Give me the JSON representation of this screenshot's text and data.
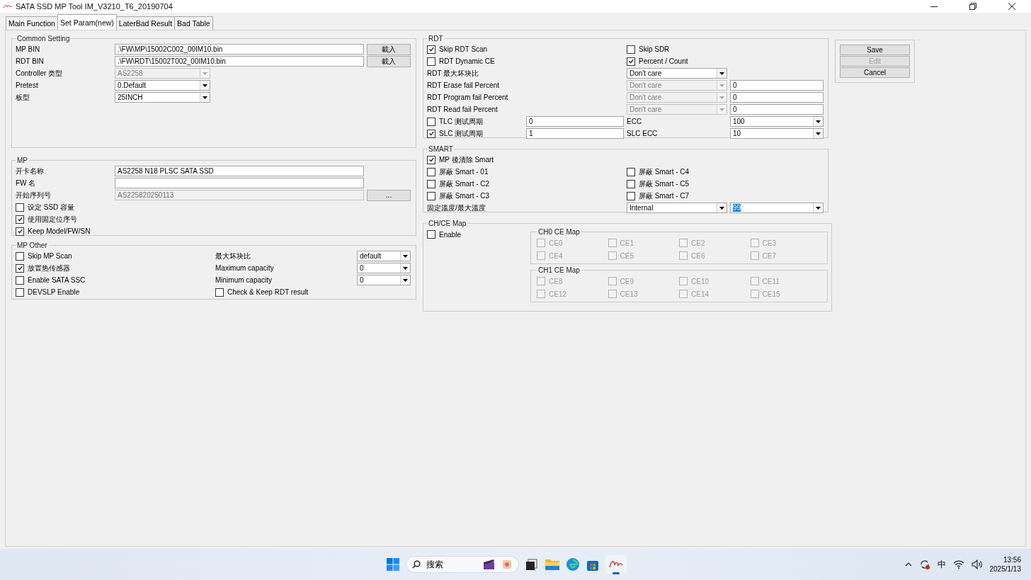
{
  "window": {
    "title": "SATA SSD MP Tool IM_V3210_T6_20190704"
  },
  "tabs": [
    {
      "label": "Main Function",
      "selected": false
    },
    {
      "label": "Set Param(new)",
      "selected": true
    },
    {
      "label": "LaterBad Result",
      "selected": false
    },
    {
      "label": "Bad Table",
      "selected": false
    }
  ],
  "common_setting": {
    "title": "Common Setting",
    "rows": [
      {
        "label": "MP BIN",
        "field": {
          "kind": "text",
          "value": ".\\FW\\MP\\15002C002_00IM10.bin",
          "disabled": false
        },
        "button": "載入"
      },
      {
        "label": "RDT BIN",
        "field": {
          "kind": "text",
          "value": ".\\FW\\RDT\\15002T002_00IM10.bin",
          "disabled": false
        },
        "button": "載入"
      },
      {
        "label": "Controller 类型",
        "field": {
          "kind": "combo",
          "value": "AS2258",
          "disabled": true
        }
      },
      {
        "label": "Pretest",
        "field": {
          "kind": "combo",
          "value": "0.Default",
          "disabled": false
        }
      },
      {
        "label": "板型",
        "field": {
          "kind": "combo",
          "value": "25INCH",
          "disabled": false
        }
      }
    ]
  },
  "mp": {
    "title": "MP",
    "rows": [
      {
        "label": "开卡名称",
        "field": {
          "kind": "text",
          "value": "AS2258 N18 PLSC SATA SSD",
          "disabled": false
        }
      },
      {
        "label": "FW 名",
        "field": {
          "kind": "text",
          "disabled": false
        }
      },
      {
        "label": "开始序列号",
        "field": {
          "kind": "text",
          "value": "AS225820250113",
          "disabled": true
        },
        "button": "..."
      }
    ],
    "checks": [
      {
        "label": "设定 SSD 容量",
        "checked": false
      },
      {
        "label": "使用固定位序号",
        "checked": true
      },
      {
        "label": "Keep Model/FW/SN",
        "checked": true
      }
    ]
  },
  "mp_other": {
    "title": "MP Other",
    "rows": [
      {
        "left": {
          "kind": "checkbox",
          "label": "Skip MP Scan",
          "checked": false
        },
        "right": {
          "kind": "label",
          "text": "最大坏块比"
        },
        "right_field": {
          "kind": "combo",
          "value": "default",
          "disabled": false
        }
      },
      {
        "left": {
          "kind": "checkbox",
          "label": "放置热传感器",
          "checked": true
        },
        "right": {
          "kind": "label",
          "text": "Maximum capacity"
        },
        "right_field": {
          "kind": "combo",
          "value": "0",
          "disabled": false
        }
      },
      {
        "left": {
          "kind": "checkbox",
          "label": "Enable SATA SSC",
          "checked": false
        },
        "right": {
          "kind": "label",
          "text": "Minimum capacity"
        },
        "right_field": {
          "kind": "combo",
          "value": "0",
          "disabled": false
        }
      },
      {
        "left": {
          "kind": "checkbox",
          "label": "DEVSLP Enable",
          "checked": false
        },
        "right": {
          "kind": "checkbox",
          "label": "Check & Keep RDT result",
          "checked": false
        }
      }
    ]
  },
  "rdt": {
    "title": "RDT",
    "rows": [
      {
        "left": {
          "kind": "checkbox",
          "label": "Skip RDT Scan",
          "checked": true
        },
        "right": {
          "kind": "checkbox",
          "label": "Skip SDR",
          "checked": false
        }
      },
      {
        "left": {
          "kind": "checkbox",
          "label": "RDT Dynamic CE",
          "checked": false
        },
        "right": {
          "kind": "checkbox",
          "label": "Percent / Count",
          "checked": true
        }
      },
      {
        "left": {
          "kind": "label",
          "text": "RDT 最大坏块比"
        },
        "right": {
          "kind": "combo",
          "value": "Don't care",
          "disabled": false
        }
      },
      {
        "left": {
          "kind": "label",
          "text": "RDT Erase fail Percent"
        },
        "right": {
          "kind": "combo",
          "value": "Don't care",
          "disabled": true
        },
        "right_field": {
          "kind": "text",
          "value": "0",
          "disabled": false
        }
      },
      {
        "left": {
          "kind": "label",
          "text": "RDT Program fail Percent"
        },
        "right": {
          "kind": "combo",
          "value": "Don't care",
          "disabled": true
        },
        "right_field": {
          "kind": "text",
          "value": "0",
          "disabled": false
        }
      },
      {
        "left": {
          "kind": "label",
          "text": "RDT Read fail Percent"
        },
        "right": {
          "kind": "combo",
          "value": "Don't care",
          "disabled": true
        },
        "right_field": {
          "kind": "text",
          "value": "0",
          "disabled": false
        }
      },
      {
        "left": {
          "kind": "checkbox",
          "label": "TLC 测试周期",
          "checked": false
        },
        "left_field": {
          "kind": "text",
          "value": "0",
          "disabled": false
        },
        "right": {
          "kind": "label",
          "text": "ECC"
        },
        "right_field": {
          "kind": "combo",
          "value": "100",
          "disabled": false
        }
      },
      {
        "left": {
          "kind": "checkbox",
          "label": "SLC 测试周期",
          "checked": true
        },
        "left_field": {
          "kind": "text",
          "value": "1",
          "disabled": false
        },
        "right": {
          "kind": "label",
          "text": "SLC ECC"
        },
        "right_field": {
          "kind": "combo",
          "value": "10",
          "disabled": false
        }
      }
    ]
  },
  "smart": {
    "title": "SMART",
    "rows": [
      {
        "left": {
          "kind": "checkbox",
          "label": "MP 後清除 Smart",
          "checked": true
        }
      },
      {
        "left": {
          "kind": "checkbox",
          "label": "屏蔽 Smart - 01",
          "checked": false
        },
        "right": {
          "kind": "checkbox",
          "label": "屏蔽 Smart - C4",
          "checked": false
        }
      },
      {
        "left": {
          "kind": "checkbox",
          "label": "屏蔽 Smart - C2",
          "checked": false
        },
        "right": {
          "kind": "checkbox",
          "label": "屏蔽 Smart - C5",
          "checked": false
        }
      },
      {
        "left": {
          "kind": "checkbox",
          "label": "屏蔽 Smart - C3",
          "checked": false
        },
        "right": {
          "kind": "checkbox",
          "label": "屏蔽 Smart - C7",
          "checked": false
        }
      },
      {
        "left": {
          "kind": "label",
          "text": "固定溫度/最大溫度"
        },
        "right": {
          "kind": "combo",
          "value": "Internal",
          "disabled": false
        },
        "right_field": {
          "kind": "combo",
          "value": "99",
          "disabled": false,
          "highlighted": true
        }
      }
    ]
  },
  "ch_ce_map": {
    "title": "CH/CE Map",
    "enable": {
      "label": "Enable",
      "checked": false
    },
    "maps": [
      {
        "title": "CH0 CE Map",
        "items": [
          {
            "label": "CE0",
            "checked": false,
            "disabled": true
          },
          {
            "label": "CE1",
            "checked": false,
            "disabled": true
          },
          {
            "label": "CE2",
            "checked": false,
            "disabled": true
          },
          {
            "label": "CE3",
            "checked": false,
            "disabled": true
          },
          {
            "label": "CE4",
            "checked": false,
            "disabled": true
          },
          {
            "label": "CE5",
            "checked": false,
            "disabled": true
          },
          {
            "label": "CE6",
            "checked": false,
            "disabled": true
          },
          {
            "label": "CE7",
            "checked": false,
            "disabled": true
          }
        ]
      },
      {
        "title": "CH1 CE Map",
        "items": [
          {
            "label": "CE8",
            "checked": false,
            "disabled": true
          },
          {
            "label": "CE9",
            "checked": false,
            "disabled": true
          },
          {
            "label": "CE10",
            "checked": false,
            "disabled": true
          },
          {
            "label": "CE11",
            "checked": false,
            "disabled": true
          },
          {
            "label": "CE12",
            "checked": false,
            "disabled": true
          },
          {
            "label": "CE13",
            "checked": false,
            "disabled": true
          },
          {
            "label": "CE14",
            "checked": false,
            "disabled": true
          },
          {
            "label": "CE15",
            "checked": false,
            "disabled": true
          }
        ]
      }
    ]
  },
  "actions": [
    {
      "label": "Save",
      "disabled": false
    },
    {
      "label": "Edit",
      "disabled": true
    },
    {
      "label": "Cancel",
      "disabled": false
    }
  ],
  "taskbar": {
    "search": "搜索",
    "input_method": "中",
    "time": "13:56",
    "date": "2025/1/13"
  }
}
